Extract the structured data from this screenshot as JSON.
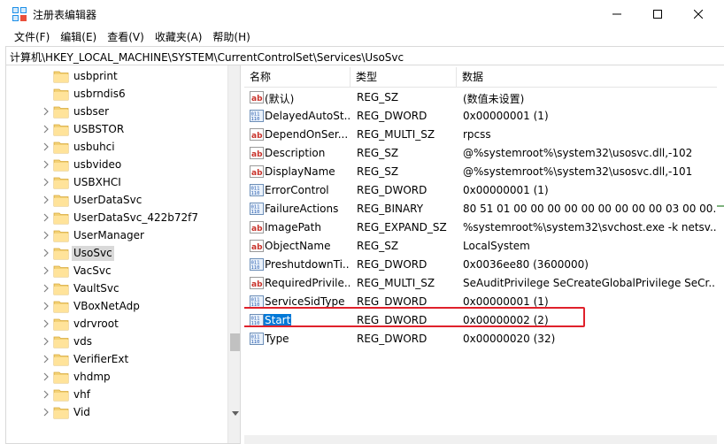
{
  "window": {
    "title": "注册表编辑器"
  },
  "menu": [
    "文件(F)",
    "编辑(E)",
    "查看(V)",
    "收藏夹(A)",
    "帮助(H)"
  ],
  "address": "计算机\\HKEY_LOCAL_MACHINE\\SYSTEM\\CurrentControlSet\\Services\\UsoSvc",
  "tree": {
    "selected": "UsoSvc",
    "items": [
      {
        "label": "usbprint",
        "expandable": false
      },
      {
        "label": "usbrndis6",
        "expandable": false
      },
      {
        "label": "usbser",
        "expandable": true
      },
      {
        "label": "USBSTOR",
        "expandable": true
      },
      {
        "label": "usbuhci",
        "expandable": true
      },
      {
        "label": "usbvideo",
        "expandable": true
      },
      {
        "label": "USBXHCI",
        "expandable": true
      },
      {
        "label": "UserDataSvc",
        "expandable": true
      },
      {
        "label": "UserDataSvc_422b72f7",
        "expandable": true
      },
      {
        "label": "UserManager",
        "expandable": true
      },
      {
        "label": "UsoSvc",
        "expandable": true
      },
      {
        "label": "VacSvc",
        "expandable": true
      },
      {
        "label": "VaultSvc",
        "expandable": true
      },
      {
        "label": "VBoxNetAdp",
        "expandable": true
      },
      {
        "label": "vdrvroot",
        "expandable": true
      },
      {
        "label": "vds",
        "expandable": true
      },
      {
        "label": "VerifierExt",
        "expandable": true
      },
      {
        "label": "vhdmp",
        "expandable": true
      },
      {
        "label": "vhf",
        "expandable": true
      },
      {
        "label": "Vid",
        "expandable": true
      }
    ]
  },
  "list": {
    "columns": [
      "名称",
      "类型",
      "数据"
    ],
    "selected": "Start",
    "rows": [
      {
        "icon": "string-value-icon",
        "name": "(默认)",
        "type": "REG_SZ",
        "data": "(数值未设置)"
      },
      {
        "icon": "binary-value-icon",
        "name": "DelayedAutoSt...",
        "type": "REG_DWORD",
        "data": "0x00000001 (1)"
      },
      {
        "icon": "string-value-icon",
        "name": "DependOnSer...",
        "type": "REG_MULTI_SZ",
        "data": "rpcss"
      },
      {
        "icon": "string-value-icon",
        "name": "Description",
        "type": "REG_SZ",
        "data": "@%systemroot%\\system32\\usosvc.dll,-102"
      },
      {
        "icon": "string-value-icon",
        "name": "DisplayName",
        "type": "REG_SZ",
        "data": "@%systemroot%\\system32\\usosvc.dll,-101"
      },
      {
        "icon": "binary-value-icon",
        "name": "ErrorControl",
        "type": "REG_DWORD",
        "data": "0x00000001 (1)"
      },
      {
        "icon": "binary-value-icon",
        "name": "FailureActions",
        "type": "REG_BINARY",
        "data": "80 51 01 00 00 00 00 00 00 00 00 00 03 00 00..."
      },
      {
        "icon": "string-value-icon",
        "name": "ImagePath",
        "type": "REG_EXPAND_SZ",
        "data": "%systemroot%\\system32\\svchost.exe -k netsv..."
      },
      {
        "icon": "string-value-icon",
        "name": "ObjectName",
        "type": "REG_SZ",
        "data": "LocalSystem"
      },
      {
        "icon": "binary-value-icon",
        "name": "PreshutdownTi...",
        "type": "REG_DWORD",
        "data": "0x0036ee80 (3600000)"
      },
      {
        "icon": "string-value-icon",
        "name": "RequiredPrivile...",
        "type": "REG_MULTI_SZ",
        "data": "SeAuditPrivilege SeCreateGlobalPrivilege SeCr..."
      },
      {
        "icon": "binary-value-icon",
        "name": "ServiceSidType",
        "type": "REG_DWORD",
        "data": "0x00000001 (1)"
      },
      {
        "icon": "binary-value-icon",
        "name": "Start",
        "type": "REG_DWORD",
        "data": "0x00000002 (2)"
      },
      {
        "icon": "binary-value-icon",
        "name": "Type",
        "type": "REG_DWORD",
        "data": "0x00000020 (32)"
      }
    ]
  },
  "colors": {
    "selection_blue": "#0078d7",
    "annotation_red": "#e0212b",
    "folder_yellow": "#f3d176"
  }
}
